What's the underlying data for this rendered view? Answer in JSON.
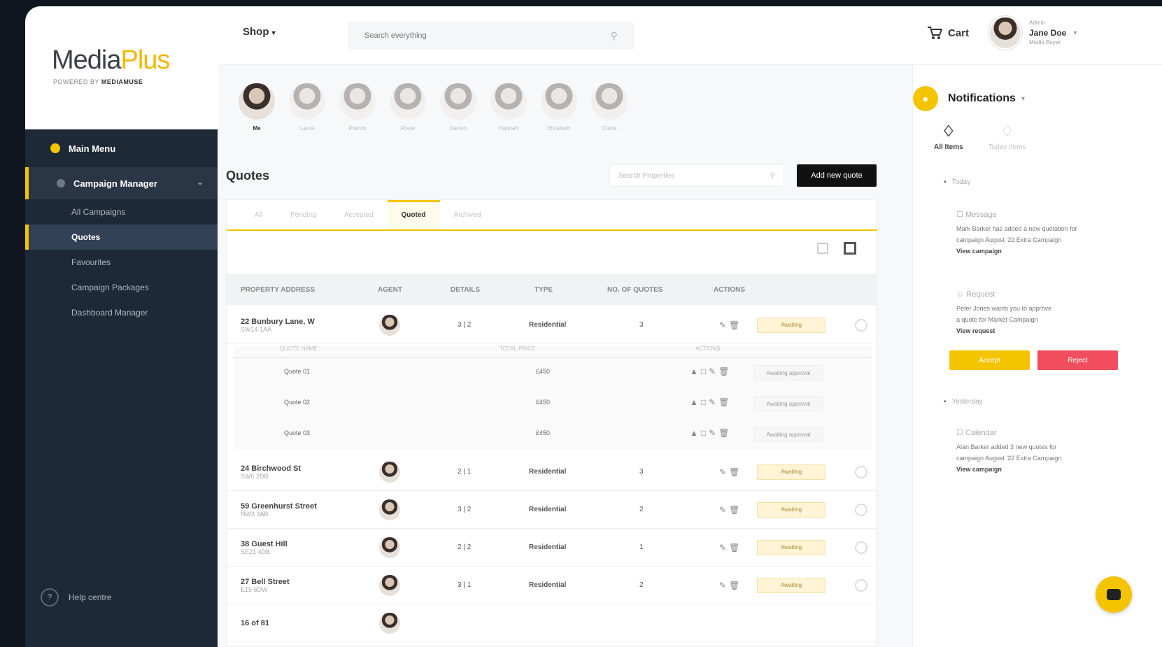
{
  "brand": {
    "name_part1": "Media",
    "name_part2": "Plus",
    "tagline_prefix": "POWERED BY",
    "tagline_brand": "MEDIAMUSE"
  },
  "sidebar": {
    "main_menu": "Main Menu",
    "section": "Campaign Manager",
    "items": [
      {
        "label": "All Campaigns"
      },
      {
        "label": "Quotes"
      },
      {
        "label": "Favourites"
      },
      {
        "label": "Campaign Packages"
      },
      {
        "label": "Dashboard Manager"
      }
    ],
    "help": "Help centre"
  },
  "topbar": {
    "shop_label": "Shop",
    "search_placeholder": "Search everything",
    "cart_label": "Cart",
    "user_role": "Admin",
    "user_name": "Jane Doe",
    "user_sub": "Media Buyer"
  },
  "avatars": [
    {
      "label": "Me"
    },
    {
      "label": "Laura"
    },
    {
      "label": "Patrick"
    },
    {
      "label": "Rosie"
    },
    {
      "label": "Darren"
    },
    {
      "label": "Hannah"
    },
    {
      "label": "Elizabeth"
    },
    {
      "label": "Claire"
    }
  ],
  "quotes": {
    "title": "Quotes",
    "search_placeholder": "Search Properties",
    "add_button": "Add new quote",
    "tabs": [
      "All",
      "Pending",
      "Accepted",
      "Quoted",
      "Archived"
    ],
    "columns": [
      "PROPERTY ADDRESS",
      "AGENT",
      "DETAILS",
      "TYPE",
      "NO. OF QUOTES",
      "ACTIONS"
    ],
    "rows": [
      {
        "address": "22 Bunbury Lane, W",
        "sub": "SW14 1AA",
        "details": "3 | 2",
        "type": "Residential",
        "count": "3",
        "status": "Awaiting"
      },
      {
        "address": "24 Birchwood St",
        "sub": "SW6 2DB",
        "details": "2 | 1",
        "type": "Residential",
        "count": "3",
        "status": "Awaiting"
      },
      {
        "address": "59 Greenhurst Street",
        "sub": "NW3 3AB",
        "details": "3 | 2",
        "type": "Residential",
        "count": "2",
        "status": "Awaiting"
      },
      {
        "address": "38 Guest Hill",
        "sub": "SE21 4DB",
        "details": "2 | 2",
        "type": "Residential",
        "count": "1",
        "status": "Awaiting"
      },
      {
        "address": "27 Bell Street",
        "sub": "E15 6DW",
        "details": "3 | 1",
        "type": "Residential",
        "count": "2",
        "status": "Awaiting"
      },
      {
        "address": "16 of 81",
        "sub": "",
        "details": "",
        "type": "",
        "count": "",
        "status": ""
      }
    ],
    "subtable": {
      "headers": [
        "QUOTE NAME",
        "TOTAL PRICE",
        "ACTIONS"
      ],
      "rows": [
        {
          "name": "Quote 01",
          "price": "£450",
          "status": "Awaiting approval"
        },
        {
          "name": "Quote 02",
          "price": "£450",
          "status": "Awaiting approval"
        },
        {
          "name": "Quote 03",
          "price": "£450",
          "status": "Awaiting approval"
        }
      ]
    }
  },
  "notifications": {
    "title": "Notifications",
    "tabs": [
      "All Items",
      "Today Items"
    ],
    "sections": [
      {
        "label": "Today"
      },
      {
        "label": "Yesterday"
      }
    ],
    "cards": [
      {
        "title": "Message",
        "line1": "Mark Barker has added a new quotation for",
        "line2": "campaign August '22 Extra Campaign",
        "link": "View campaign"
      },
      {
        "title": "Request",
        "line1": "Peter Jones wants you to approve",
        "line2": "a quote for Market Campaign",
        "link": "View request"
      },
      {
        "title": "Calendar",
        "line1": "Alan Barker added 3 new quotes for",
        "line2": "campaign August '22 Extra Campaign",
        "link": "View campaign"
      }
    ],
    "accept_label": "Accept",
    "reject_label": "Reject"
  },
  "colors": {
    "accent": "#f5c400",
    "sidebar": "#1e2937",
    "danger": "#f04e5e"
  }
}
